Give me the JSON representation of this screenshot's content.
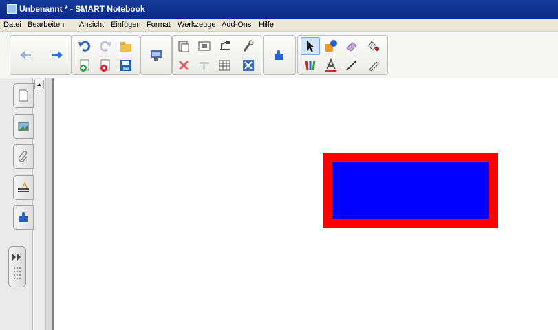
{
  "window": {
    "title": "Unbenannt * - SMART Notebook"
  },
  "menu": [
    "Datei",
    "Bearbeiten",
    "Ansicht",
    "Einfügen",
    "Format",
    "Werkzeuge",
    "Add-Ons",
    "Hilfe"
  ],
  "toolbar": {
    "icons": [
      "back-arrow-icon",
      "forward-arrow-icon",
      "undo-icon",
      "redo-icon",
      "open-folder-icon",
      "add-page-icon",
      "delete-page-icon",
      "save-icon",
      "screen-shade-icon",
      "paste-icon",
      "screen-capture-icon",
      "document-camera-icon",
      "table-icon",
      "delete-icon",
      "properties-icon",
      "full-screen-icon",
      "magic-pen-icon",
      "add-ons-icon",
      "select-pointer-icon",
      "shapes-icon",
      "eraser-icon",
      "fill-icon",
      "pens-icon",
      "text-icon",
      "line-icon",
      "creative-pen-icon"
    ]
  },
  "side_tabs": [
    "page-sorter-icon",
    "gallery-icon",
    "attachments-icon",
    "properties-icon",
    "add-ons-icon"
  ],
  "canvas": {
    "shape": {
      "type": "rectangle",
      "fill": "#0000ff",
      "border": "#ff0000"
    }
  },
  "colors": {
    "titlebar": "#0a2a86",
    "menubar": "#ece9d8"
  }
}
